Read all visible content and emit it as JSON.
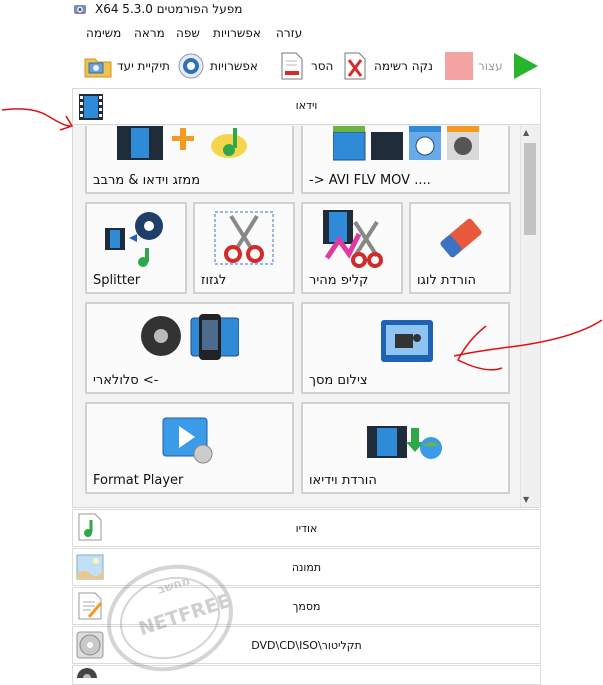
{
  "window": {
    "title": "מפעל הפורמטים X64 5.3.0"
  },
  "menu": {
    "items": [
      {
        "label": "משימה"
      },
      {
        "label": "מראה"
      },
      {
        "label": "שפה"
      },
      {
        "label": "אפשרויות"
      },
      {
        "label": "עזרה"
      }
    ]
  },
  "toolbar": {
    "output_folder": "תיקיית יעד",
    "options": "אפשרויות",
    "remove": "הסר",
    "clear_list": "נקה רשימה",
    "stop": "עצור"
  },
  "categories": {
    "video": "וידאו",
    "audio": "אודיו",
    "image": "תמונה",
    "document": "מסמך",
    "disc": "תקליטור\\DVD\\CD\\ISO"
  },
  "tiles": [
    {
      "label": "ממזג וידאו & מרבב"
    },
    {
      "label": "-> AVI FLV MOV ...."
    },
    {
      "label": "Splitter"
    },
    {
      "label": "לגזוז"
    },
    {
      "label": "קליפ מהיר"
    },
    {
      "label": "הורדת לוגו"
    },
    {
      "label": "-> סלולארי"
    },
    {
      "label": "צילום מסך"
    },
    {
      "label": "Format Player"
    },
    {
      "label": "הורדת וידיאו"
    }
  ],
  "watermark": {
    "text": "NETFREE",
    "subtext": "מחשב"
  },
  "colors": {
    "annotation": "#e01010",
    "accent_blue": "#1e63b6",
    "play_green": "#27b52c"
  },
  "icons": {
    "app": "format-factory-icon",
    "output_folder": "folder-icon",
    "options": "gear-icon",
    "remove": "document-remove-icon",
    "clear_list": "document-clear-icon",
    "stop": "stop-icon",
    "start": "play-icon"
  }
}
